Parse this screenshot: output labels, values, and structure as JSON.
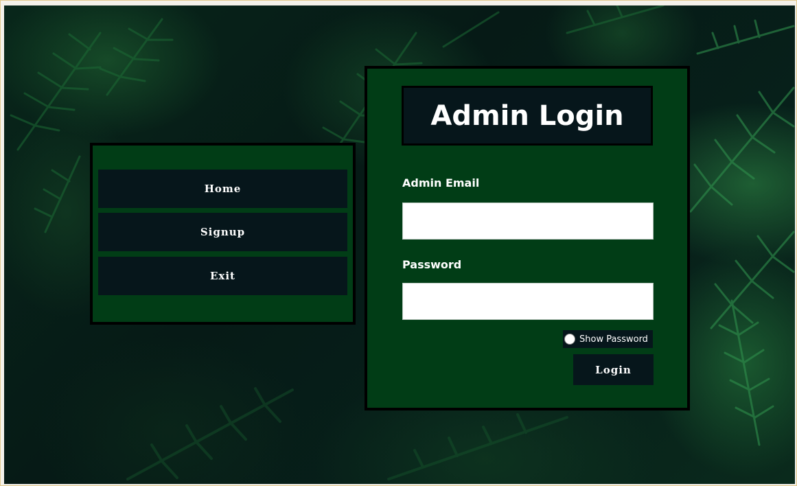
{
  "nav": {
    "items": [
      {
        "label": "Home"
      },
      {
        "label": "Signup"
      },
      {
        "label": "Exit"
      }
    ]
  },
  "login": {
    "title": "Admin Login",
    "email_label": "Admin Email",
    "email_value": "",
    "password_label": "Password",
    "password_value": "",
    "show_password_label": "Show Password",
    "show_password_checked": false,
    "submit_label": "Login"
  },
  "colors": {
    "panel_green": "#013d16",
    "button_dark": "#06161b",
    "panel_border": "#000000",
    "input_background": "#ffffff",
    "text": "#ffffff"
  }
}
